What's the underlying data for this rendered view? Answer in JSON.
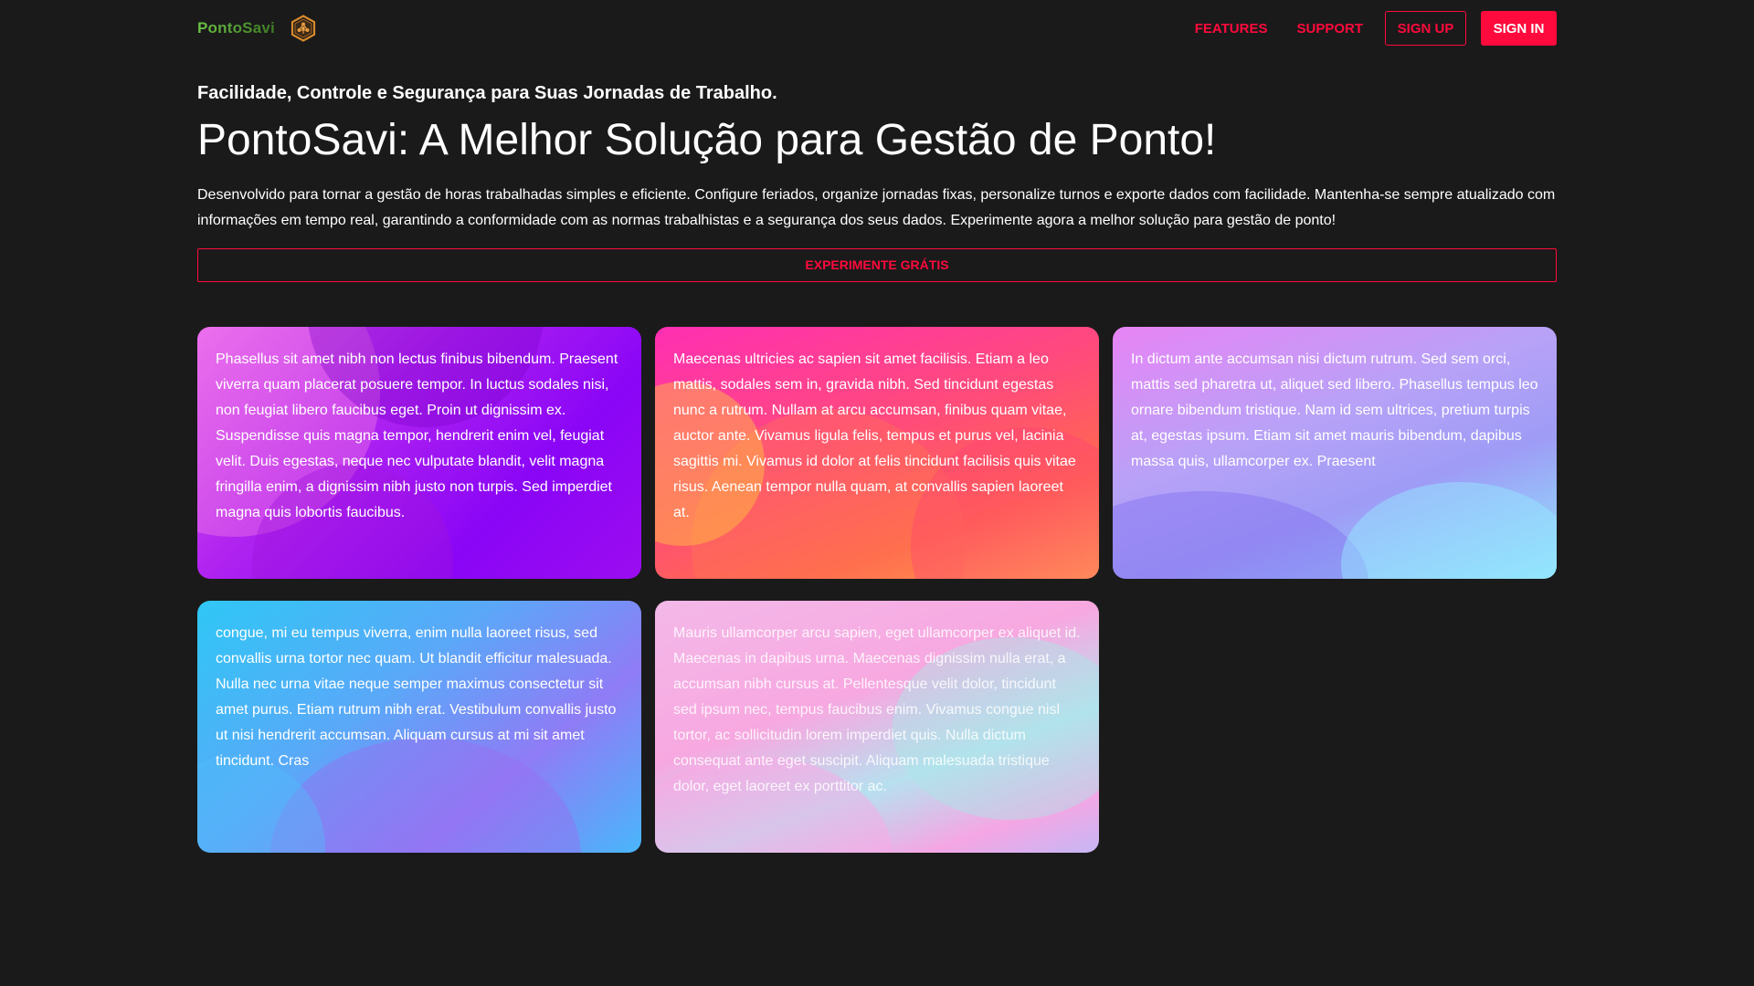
{
  "colors": {
    "background": "#1a1a1a",
    "accent": "#ff0a3c",
    "brand_green": "#6ac144",
    "brand_dark": "#3d7a25",
    "logo_orange": "#d88a2c"
  },
  "navbar": {
    "brand_name": "PontoSavi",
    "logo_icon": "hexagon-network-logo",
    "links": [
      {
        "label": "FEATURES"
      },
      {
        "label": "SUPPORT"
      }
    ],
    "sign_up_label": "SIGN UP",
    "sign_in_label": "SIGN IN"
  },
  "hero": {
    "subtitle": "Facilidade, Controle e Segurança para Suas Jornadas de Trabalho.",
    "title": "PontoSavi: A Melhor Solução para Gestão de Ponto!",
    "description": "Desenvolvido para tornar a gestão de horas trabalhadas simples e eficiente. Configure feriados, organize jornadas fixas, personalize turnos e exporte dados com facilidade. Mantenha-se sempre atualizado com informações em tempo real, garantindo a conformidade com as normas trabalhistas e a segurança dos seus dados. Experimente agora a melhor solução para gestão de ponto!",
    "cta_label": "EXPERIMENTE GRÁTIS"
  },
  "cards": [
    {
      "text": "Phasellus sit amet nibh non lectus finibus bibendum. Praesent viverra quam placerat posuere tempor. In luctus sodales nisi, non feugiat libero faucibus eget. Proin ut dignissim ex. Suspendisse quis magna tempor, hendrerit enim vel, feugiat velit. Duis egestas, neque nec vulputate blandit, velit magna fringilla enim, a dignissim nibh justo non turpis. Sed imperdiet magna quis lobortis faucibus."
    },
    {
      "text": "Maecenas ultricies ac sapien sit amet facilisis. Etiam a leo mattis, sodales sem in, gravida nibh. Sed tincidunt egestas nunc a rutrum. Nullam at arcu accumsan, finibus quam vitae, auctor ante. Vivamus ligula felis, tempus et purus vel, lacinia sagittis mi. Vivamus id dolor at felis tincidunt facilisis quis vitae risus. Aenean tempor nulla quam, at convallis sapien laoreet at."
    },
    {
      "text": "In dictum ante accumsan nisi dictum rutrum. Sed sem orci, mattis sed pharetra ut, aliquet sed libero. Phasellus tempus leo ornare bibendum tristique. Nam id sem ultrices, pretium turpis at, egestas ipsum. Etiam sit amet mauris bibendum, dapibus massa quis, ullamcorper ex. Praesent"
    },
    {
      "text": "congue, mi eu tempus viverra, enim nulla laoreet risus, sed convallis urna tortor nec quam. Ut blandit efficitur malesuada. Nulla nec urna vitae neque semper maximus consectetur sit amet purus. Etiam rutrum nibh erat. Vestibulum convallis justo ut nisi hendrerit accumsan. Aliquam cursus at mi sit amet tincidunt. Cras"
    },
    {
      "text": "Mauris ullamcorper arcu sapien, eget ullamcorper ex aliquet id. Maecenas in dapibus urna. Maecenas dignissim nulla erat, a accumsan nibh cursus at. Pellentesque velit dolor, tincidunt sed ipsum nec, tempus faucibus enim. Vivamus congue nisl tortor, ac sollicitudin lorem imperdiet quis. Nulla dictum consequat ante eget suscipit. Aliquam malesuada tristique dolor, eget laoreet ex porttitor ac."
    }
  ]
}
